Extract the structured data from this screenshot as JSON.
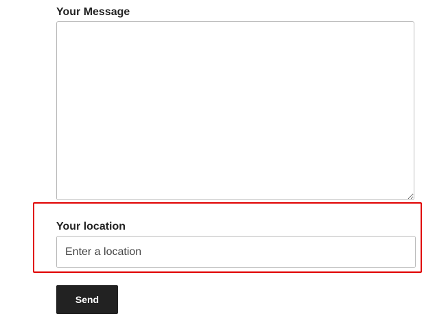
{
  "form": {
    "message": {
      "label": "Your Message",
      "value": ""
    },
    "location": {
      "label": "Your location",
      "placeholder": "Enter a location",
      "value": ""
    },
    "send_label": "Send"
  },
  "colors": {
    "highlight_border": "#e00000",
    "button_bg": "#222222",
    "button_text": "#ffffff",
    "field_border": "#bbbbbb"
  }
}
